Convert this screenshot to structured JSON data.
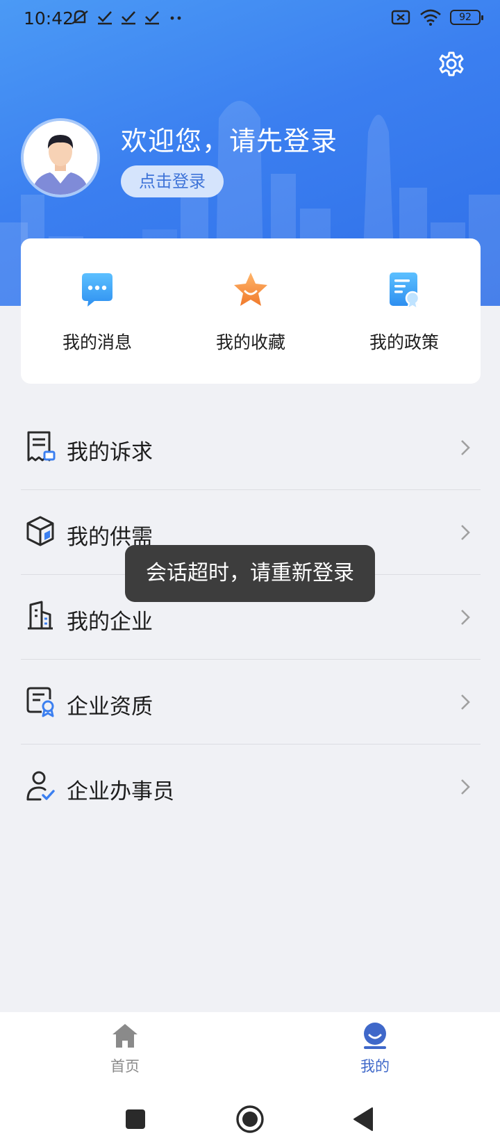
{
  "status_bar": {
    "time": "10:42",
    "battery": "92"
  },
  "header": {
    "welcome_text": "欢迎您，请先登录",
    "login_button": "点击登录"
  },
  "quick_actions": [
    {
      "label": "我的消息",
      "icon": "message-icon"
    },
    {
      "label": "我的收藏",
      "icon": "star-icon"
    },
    {
      "label": "我的政策",
      "icon": "policy-doc-icon"
    }
  ],
  "menu": [
    {
      "label": "我的诉求",
      "icon": "appeal-doc-icon"
    },
    {
      "label": "我的供需",
      "icon": "box-icon"
    },
    {
      "label": "我的企业",
      "icon": "building-icon"
    },
    {
      "label": "企业资质",
      "icon": "certificate-icon"
    },
    {
      "label": "企业办事员",
      "icon": "user-check-icon"
    }
  ],
  "toast": {
    "message": "会话超时，请重新登录"
  },
  "bottom_nav": [
    {
      "label": "首页",
      "icon": "home-icon",
      "active": false
    },
    {
      "label": "我的",
      "icon": "profile-icon",
      "active": true
    }
  ],
  "colors": {
    "accent": "#3b7ff0",
    "nav_active": "#3f68c9",
    "nav_inactive": "#8a8a8a",
    "toast_bg": "#3d3d3d"
  }
}
